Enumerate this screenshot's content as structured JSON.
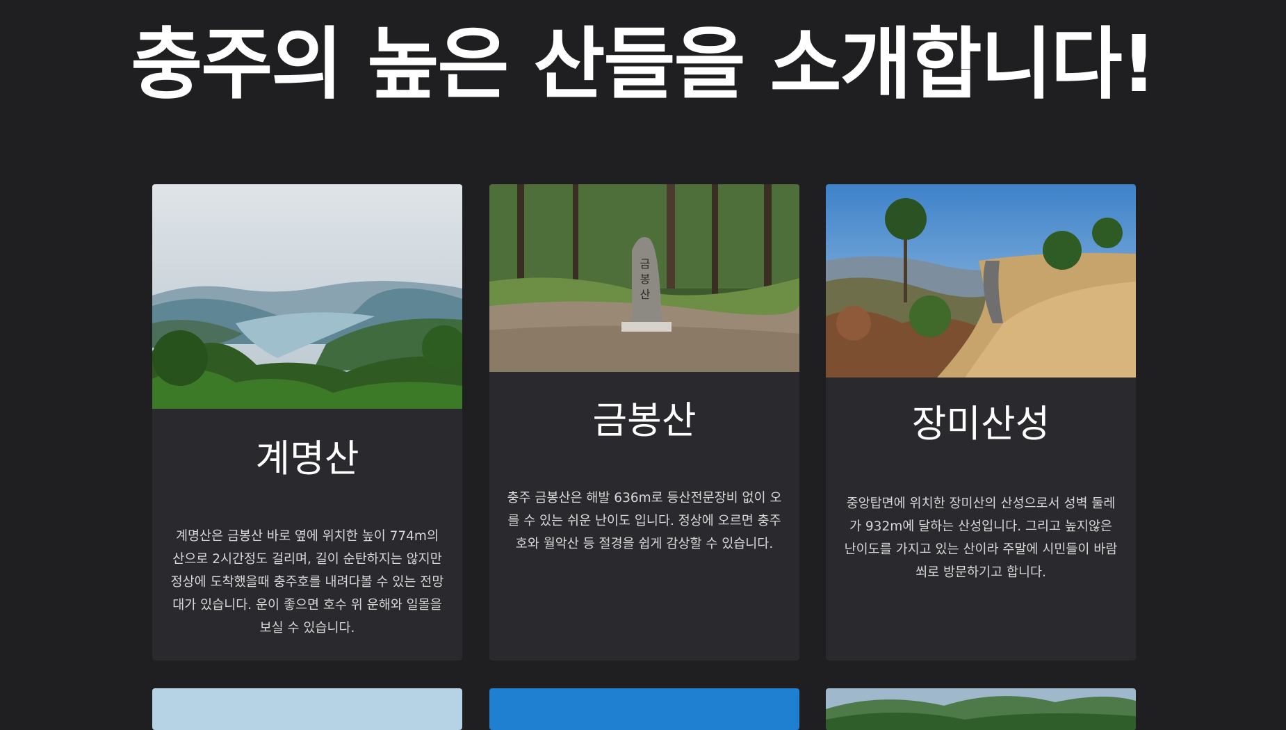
{
  "page": {
    "title": "충주의 높은 산들을 소개합니다!",
    "background": "#1f1f22",
    "card_background": "#2a2a2e"
  },
  "mountains": [
    {
      "name": "계명산",
      "description": "계명산은 금봉산 바로 옆에 위치한 높이 774m의 산으로 2시간정도 걸리며, 길이 순탄하지는 않지만 정상에 도착했을때 충주호를 내려다볼 수 있는 전망대가 있습니다. 운이 좋으면 호수 위 운해와 일몰을 보실 수 있습니다."
    },
    {
      "name": "금봉산",
      "description": "충주 금봉산은 해발 636m로 등산전문장비 없이 오를 수 있는 쉬운 난이도 입니다. 정상에 오르면 충주호와 월악산 등 절경을 쉽게 감상할 수 있습니다."
    },
    {
      "name": "장미산성",
      "description": "중앙탑면에 위치한 장미산의 산성으로서 성벽 둘레가 932m에 달하는 산성입니다. 그리고 높지않은 난이도를 가지고 있는 산이라 주말에 시민들이 바람 쐬로 방문하기고 합니다."
    }
  ]
}
